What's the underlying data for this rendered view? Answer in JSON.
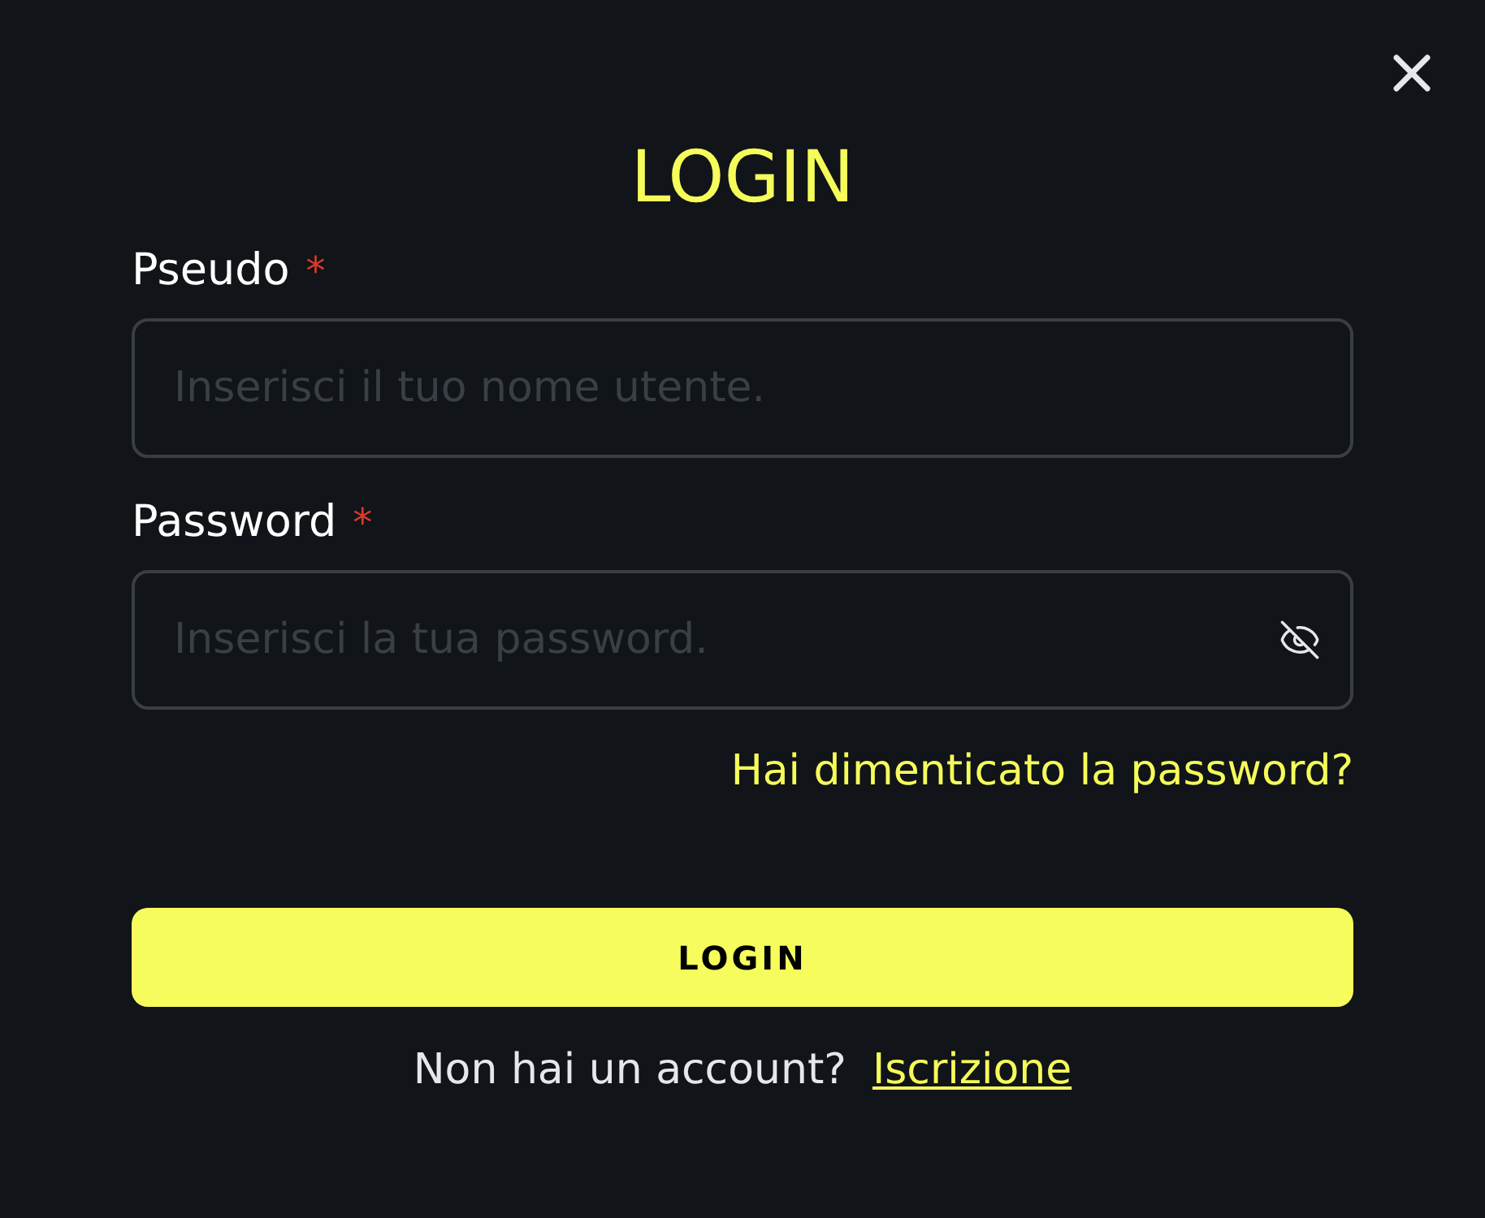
{
  "title": "LOGIN",
  "fields": [
    {
      "kind": "text",
      "label": "Pseudo",
      "required_mark": "*",
      "placeholder": "Inserisci il tuo nome utente."
    },
    {
      "kind": "password",
      "label": "Password",
      "required_mark": "*",
      "placeholder": "Inserisci la tua password."
    }
  ],
  "forgot_link": "Hai dimenticato la password?",
  "submit_button": "LOGIN",
  "signup": {
    "prompt": "Non hai un account?",
    "link": "Iscrizione"
  }
}
